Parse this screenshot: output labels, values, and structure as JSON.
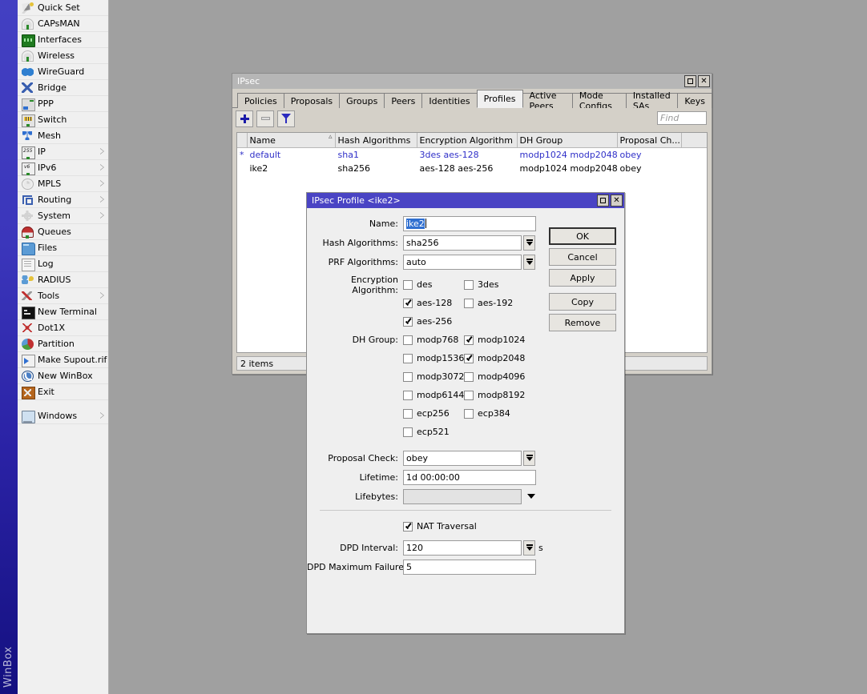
{
  "app": {
    "brand": "WinBox"
  },
  "sidebar": {
    "items": [
      {
        "label": "Quick Set",
        "icon": "quickset-icon",
        "submenu": false
      },
      {
        "label": "CAPsMAN",
        "icon": "capsman-icon",
        "submenu": false
      },
      {
        "label": "Interfaces",
        "icon": "interfaces-icon",
        "submenu": false
      },
      {
        "label": "Wireless",
        "icon": "wireless-icon",
        "submenu": false
      },
      {
        "label": "WireGuard",
        "icon": "wireguard-icon",
        "submenu": false
      },
      {
        "label": "Bridge",
        "icon": "bridge-icon",
        "submenu": false
      },
      {
        "label": "PPP",
        "icon": "ppp-icon",
        "submenu": false
      },
      {
        "label": "Switch",
        "icon": "switch-icon",
        "submenu": false
      },
      {
        "label": "Mesh",
        "icon": "mesh-icon",
        "submenu": false
      },
      {
        "label": "IP",
        "icon": "ip-icon",
        "submenu": true
      },
      {
        "label": "IPv6",
        "icon": "ipv6-icon",
        "submenu": true
      },
      {
        "label": "MPLS",
        "icon": "mpls-icon",
        "submenu": true
      },
      {
        "label": "Routing",
        "icon": "routing-icon",
        "submenu": true
      },
      {
        "label": "System",
        "icon": "system-icon",
        "submenu": true
      },
      {
        "label": "Queues",
        "icon": "queues-icon",
        "submenu": false
      },
      {
        "label": "Files",
        "icon": "files-icon",
        "submenu": false
      },
      {
        "label": "Log",
        "icon": "log-icon",
        "submenu": false
      },
      {
        "label": "RADIUS",
        "icon": "radius-icon",
        "submenu": false
      },
      {
        "label": "Tools",
        "icon": "tools-icon",
        "submenu": true
      },
      {
        "label": "New Terminal",
        "icon": "terminal-icon",
        "submenu": false
      },
      {
        "label": "Dot1X",
        "icon": "dot1x-icon",
        "submenu": false
      },
      {
        "label": "Partition",
        "icon": "partition-icon",
        "submenu": false
      },
      {
        "label": "Make Supout.rif",
        "icon": "supout-icon",
        "submenu": false
      },
      {
        "label": "New WinBox",
        "icon": "new-winbox-icon",
        "submenu": false
      },
      {
        "label": "Exit",
        "icon": "exit-icon",
        "submenu": false
      }
    ],
    "windows_item": {
      "label": "Windows",
      "icon": "windows-icon",
      "submenu": true
    }
  },
  "ipsec_window": {
    "title": "IPsec",
    "titlebar_buttons": {
      "restore": "restore-icon",
      "close": "close-icon"
    },
    "tabs": [
      {
        "label": "Policies",
        "active": false
      },
      {
        "label": "Proposals",
        "active": false
      },
      {
        "label": "Groups",
        "active": false
      },
      {
        "label": "Peers",
        "active": false
      },
      {
        "label": "Identities",
        "active": false
      },
      {
        "label": "Profiles",
        "active": true
      },
      {
        "label": "Active Peers",
        "active": false
      },
      {
        "label": "Mode Configs",
        "active": false
      },
      {
        "label": "Installed SAs",
        "active": false
      },
      {
        "label": "Keys",
        "active": false
      }
    ],
    "toolbar": {
      "add_label": "add-button",
      "remove_label": "remove-button",
      "filter_label": "filter-button",
      "find_placeholder": "Find"
    },
    "grid": {
      "columns": [
        "Name",
        "Hash Algorithms",
        "Encryption Algorithm",
        "DH Group",
        "Proposal Ch..."
      ],
      "sorted_column": "Name",
      "rows": [
        {
          "flag": "*",
          "name": "default",
          "hash": "sha1",
          "encryption": "3des aes-128",
          "dh_group": "modp1024 modp2048",
          "proposal_check": "obey",
          "style": "default"
        },
        {
          "flag": "",
          "name": "ike2",
          "hash": "sha256",
          "encryption": "aes-128 aes-256",
          "dh_group": "modp1024 modp2048",
          "proposal_check": "obey",
          "style": "plain"
        }
      ]
    },
    "status": "2 items"
  },
  "profile_dialog": {
    "title": "IPsec Profile <ike2>",
    "titlebar_buttons": {
      "restore": "restore-icon",
      "close": "close-icon"
    },
    "fields": {
      "name": {
        "label": "Name:",
        "value": "ike2",
        "selected": true
      },
      "hash_algorithms": {
        "label": "Hash Algorithms:",
        "value": "sha256"
      },
      "prf_algorithms": {
        "label": "PRF Algorithms:",
        "value": "auto"
      },
      "proposal_check": {
        "label": "Proposal Check:",
        "value": "obey"
      },
      "lifetime": {
        "label": "Lifetime:",
        "value": "1d 00:00:00"
      },
      "lifebytes": {
        "label": "Lifebytes:",
        "value": ""
      },
      "dpd_interval": {
        "label": "DPD Interval:",
        "value": "120",
        "unit": "s"
      },
      "dpd_max_failures": {
        "label": "DPD Maximum Failures:",
        "value": "5"
      }
    },
    "encryption_algorithm": {
      "label": "Encryption Algorithm:",
      "options": [
        {
          "label": "des",
          "checked": false
        },
        {
          "label": "3des",
          "checked": false
        },
        {
          "label": "aes-128",
          "checked": true
        },
        {
          "label": "aes-192",
          "checked": false
        },
        {
          "label": "aes-256",
          "checked": true
        }
      ]
    },
    "dh_group": {
      "label": "DH Group:",
      "options": [
        {
          "label": "modp768",
          "checked": false
        },
        {
          "label": "modp1024",
          "checked": true
        },
        {
          "label": "modp1536",
          "checked": false
        },
        {
          "label": "modp2048",
          "checked": true
        },
        {
          "label": "modp3072",
          "checked": false
        },
        {
          "label": "modp4096",
          "checked": false
        },
        {
          "label": "modp6144",
          "checked": false
        },
        {
          "label": "modp8192",
          "checked": false
        },
        {
          "label": "ecp256",
          "checked": false
        },
        {
          "label": "ecp384",
          "checked": false
        },
        {
          "label": "ecp521",
          "checked": false
        }
      ]
    },
    "nat_traversal": {
      "label": "NAT Traversal",
      "checked": true
    },
    "buttons": [
      {
        "label": "OK",
        "primary": true
      },
      {
        "label": "Cancel",
        "primary": false
      },
      {
        "label": "Apply",
        "primary": false
      },
      {
        "label": "Copy",
        "primary": false
      },
      {
        "label": "Remove",
        "primary": false
      }
    ]
  },
  "colors": {
    "desktop": "#a0a0a0",
    "window_face": "#d4d0c8",
    "dialog_face": "#efefef",
    "title_active": "#4a44c4",
    "title_inactive": "#b6b6b6",
    "row_default_text": "#2f2fc8",
    "selection": "#2f6fd0",
    "brand_gradient_top": "#4340c2",
    "brand_gradient_bottom": "#141080"
  }
}
